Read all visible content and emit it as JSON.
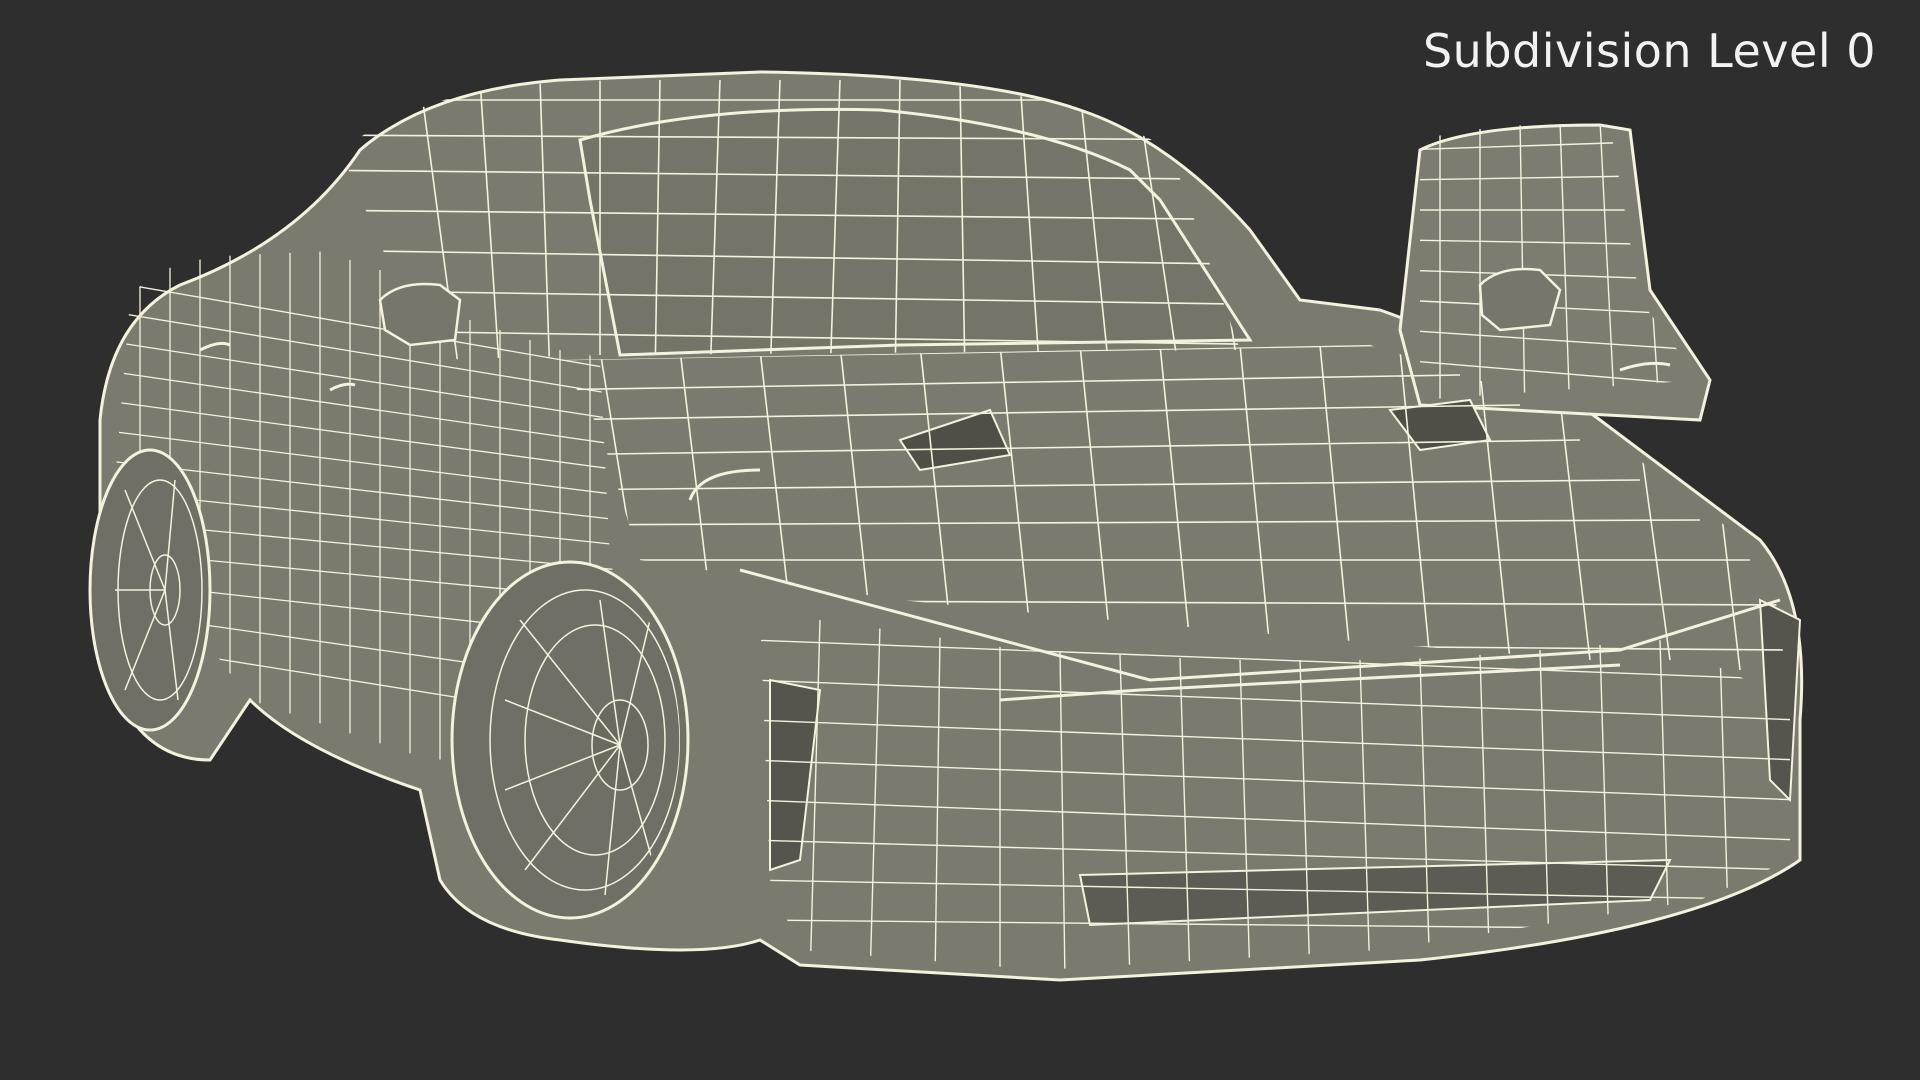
{
  "viewport": {
    "label": "Subdivision Level 0",
    "background_color": "#2e2e2e",
    "model_surface_color": "#7a7a6f",
    "wire_color": "#f4f1dc"
  },
  "model": {
    "subject": "car-wireframe-model"
  }
}
